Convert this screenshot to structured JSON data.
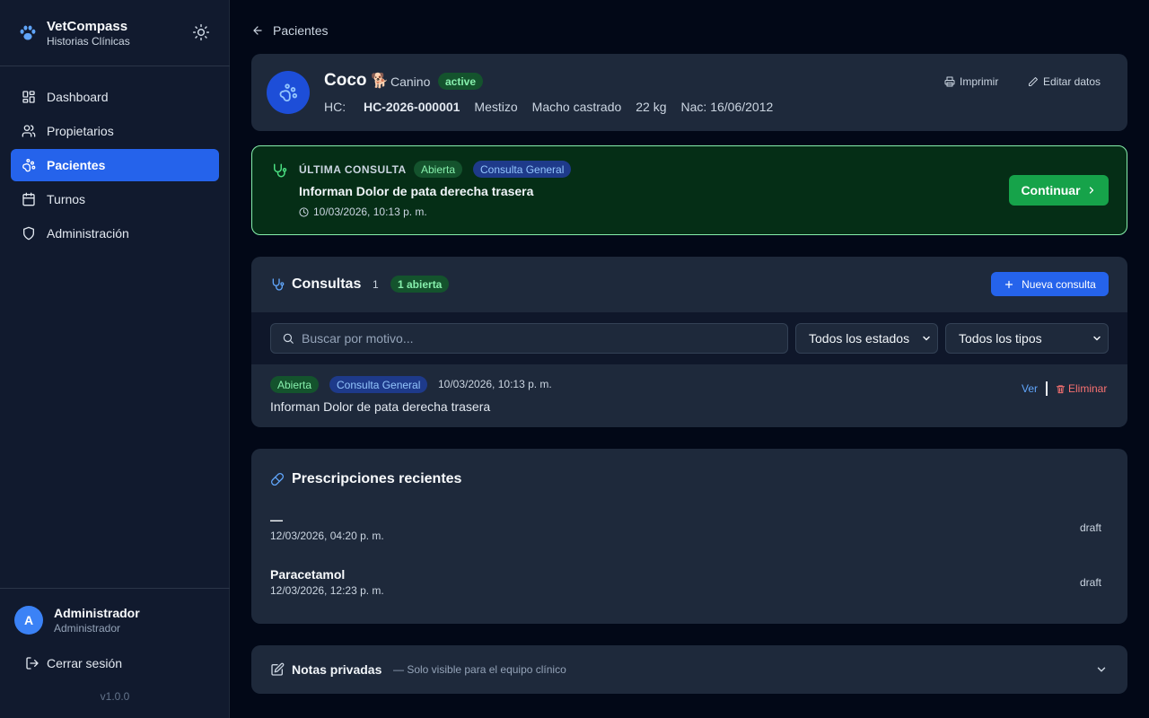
{
  "brand": {
    "title": "VetCompass",
    "subtitle": "Historias Clínicas"
  },
  "sidebar": {
    "items": [
      {
        "label": "Dashboard",
        "icon": "dashboard-icon"
      },
      {
        "label": "Propietarios",
        "icon": "users-icon"
      },
      {
        "label": "Pacientes",
        "icon": "paw-icon",
        "active": true
      },
      {
        "label": "Turnos",
        "icon": "calendar-icon"
      },
      {
        "label": "Administración",
        "icon": "shield-icon"
      }
    ],
    "user": {
      "initial": "A",
      "name": "Administrador",
      "role": "Administrador"
    },
    "logout_label": "Cerrar sesión",
    "version": "v1.0.0"
  },
  "header": {
    "back_label": "Pacientes"
  },
  "patient": {
    "name": "Coco",
    "emoji": "🐕",
    "species": "Canino",
    "status": "active",
    "hc_label": "HC:",
    "hc_number": "HC-2026-000001",
    "breed": "Mestizo",
    "sex": "Macho castrado",
    "weight": "22 kg",
    "birth": "Nac: 16/06/2012",
    "print_label": "Imprimir",
    "edit_label": "Editar datos"
  },
  "last_consult": {
    "label": "ÚLTIMA CONSULTA",
    "status": "Abierta",
    "type": "Consulta General",
    "title": "Informan Dolor de pata derecha trasera",
    "date": "10/03/2026, 10:13 p. m.",
    "continue_label": "Continuar"
  },
  "consults": {
    "title": "Consultas",
    "count": "1",
    "open_badge": "1 abierta",
    "new_label": "Nueva consulta",
    "search_placeholder": "Buscar por motivo...",
    "filter_status": "Todos los estados",
    "filter_type": "Todos los tipos",
    "rows": [
      {
        "status": "Abierta",
        "type": "Consulta General",
        "date": "10/03/2026, 10:13 p. m.",
        "title": "Informan Dolor de pata derecha trasera",
        "view_label": "Ver",
        "delete_label": "Eliminar"
      }
    ]
  },
  "prescriptions": {
    "title": "Prescripciones recientes",
    "items": [
      {
        "name": "—",
        "date": "12/03/2026, 04:20 p. m.",
        "status": "draft"
      },
      {
        "name": "Paracetamol",
        "date": "12/03/2026, 12:23 p. m.",
        "status": "draft"
      }
    ]
  },
  "notes": {
    "title": "Notas privadas",
    "description": "— Solo visible para el equipo clínico"
  },
  "colors": {
    "accent": "#2563eb",
    "success": "#16a34a",
    "danger": "#f87171",
    "background": "#020817",
    "card": "#1e293b"
  }
}
